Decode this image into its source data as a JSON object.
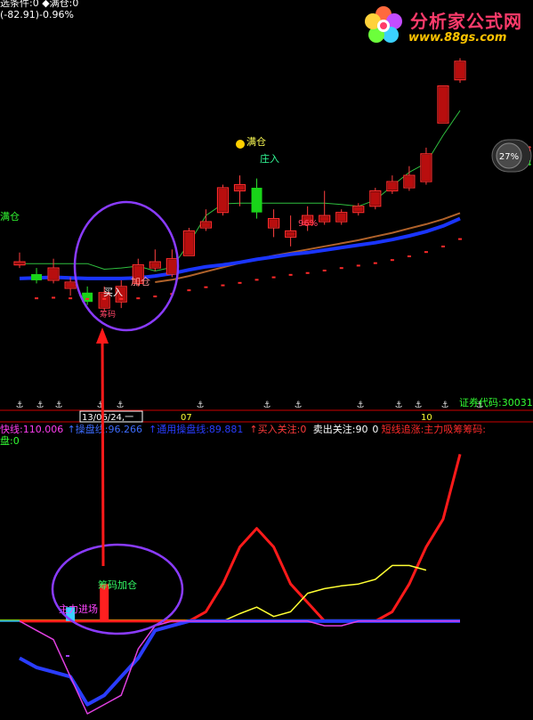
{
  "header": {
    "line1": "选条件:0 ◆满仓:0",
    "line2": "(-82.91)-0.96%"
  },
  "watermark": {
    "title": "分析家公式网",
    "url": "www.88gs.com"
  },
  "gauge": {
    "value": "27%"
  },
  "price_panel": {
    "labels": {
      "jiacang": "加仓",
      "mairu": "买入",
      "zhuangru": "庄入",
      "mancang": "满仓",
      "pct": "96%"
    },
    "pink_note": "筹码",
    "top_left_note": "满仓"
  },
  "time_axis": {
    "date_box": "13/06/24,一",
    "month_07": "07",
    "month_10": "10",
    "code_label": "证券代码:30031"
  },
  "indicator_legend": {
    "items": [
      {
        "text": "快线:110.006",
        "color": "#ff3df0"
      },
      {
        "text": "↑操盘线:96.266",
        "color": "#3d6cff"
      },
      {
        "text": "↑通用操盘线:89.881",
        "color": "#2a3dff"
      },
      {
        "text": "↑买入关注:0",
        "color": "#ff3b3b"
      },
      {
        "text": "卖出关注:90",
        "color": "#ffffff"
      },
      {
        "text": "0",
        "color": "#ffffff"
      },
      {
        "text": "短线追涨:主力吸筹筹码:",
        "color": "#ff2a2a"
      }
    ],
    "line2": "盘:0"
  },
  "annotations": {
    "chouma": "筹码加仓",
    "zhuli": "主力进场"
  },
  "chart_data": [
    {
      "type": "candlestick",
      "candles": [
        {
          "o": 47.0,
          "c": 47.5,
          "h": 49.0,
          "l": 46.5
        },
        {
          "o": 45.5,
          "c": 44.5,
          "h": 46.5,
          "l": 44.0
        },
        {
          "o": 44.5,
          "c": 46.5,
          "h": 48.0,
          "l": 44.0
        },
        {
          "o": 43.2,
          "c": 44.2,
          "h": 45.0,
          "l": 42.0
        },
        {
          "o": 42.5,
          "c": 41.0,
          "h": 43.5,
          "l": 40.5
        },
        {
          "o": 40.0,
          "c": 42.5,
          "h": 43.5,
          "l": 39.5
        },
        {
          "o": 41.0,
          "c": 43.5,
          "h": 44.5,
          "l": 40.0
        },
        {
          "o": 44.0,
          "c": 47.0,
          "h": 48.0,
          "l": 43.5
        },
        {
          "o": 46.5,
          "c": 47.5,
          "h": 49.5,
          "l": 46.0
        },
        {
          "o": 45.5,
          "c": 48.0,
          "h": 49.5,
          "l": 45.0
        },
        {
          "o": 48.5,
          "c": 52.5,
          "h": 53.0,
          "l": 48.5
        },
        {
          "o": 53.0,
          "c": 54.0,
          "h": 56.0,
          "l": 52.5
        },
        {
          "o": 55.5,
          "c": 59.5,
          "h": 60.0,
          "l": 55.0
        },
        {
          "o": 59.0,
          "c": 60.0,
          "h": 61.5,
          "l": 56.5
        },
        {
          "o": 59.5,
          "c": 55.5,
          "h": 61.0,
          "l": 54.5
        },
        {
          "o": 53.0,
          "c": 54.5,
          "h": 56.0,
          "l": 51.5
        },
        {
          "o": 51.5,
          "c": 52.5,
          "h": 55.0,
          "l": 50.0
        },
        {
          "o": 53.5,
          "c": 55.0,
          "h": 56.5,
          "l": 52.5
        },
        {
          "o": 54.0,
          "c": 55.0,
          "h": 59.0,
          "l": 53.5
        },
        {
          "o": 54.0,
          "c": 55.5,
          "h": 56.0,
          "l": 53.5
        },
        {
          "o": 55.5,
          "c": 56.5,
          "h": 57.0,
          "l": 55.0
        },
        {
          "o": 56.5,
          "c": 59.0,
          "h": 59.5,
          "l": 56.0
        },
        {
          "o": 59.0,
          "c": 60.5,
          "h": 61.5,
          "l": 58.5
        },
        {
          "o": 59.5,
          "c": 61.5,
          "h": 63.0,
          "l": 59.0
        },
        {
          "o": 60.5,
          "c": 65.0,
          "h": 66.0,
          "l": 60.0
        },
        {
          "o": 70.0,
          "c": 76.0,
          "h": 76.0,
          "l": 70.0
        },
        {
          "o": 77.0,
          "c": 80.0,
          "h": 80.5,
          "l": 76.5
        }
      ],
      "ma_blue": [
        44.8,
        44.9,
        45.0,
        44.9,
        44.8,
        44.8,
        44.8,
        44.9,
        45.2,
        45.6,
        46.2,
        46.7,
        47.0,
        47.4,
        47.9,
        48.3,
        48.7,
        49.0,
        49.4,
        49.8,
        50.2,
        50.6,
        51.1,
        51.7,
        52.4,
        53.3,
        54.5
      ],
      "ma_brown": [
        null,
        null,
        null,
        null,
        null,
        null,
        null,
        null,
        44.2,
        44.6,
        45.2,
        45.9,
        46.6,
        47.3,
        47.9,
        48.5,
        49.0,
        49.5,
        50.0,
        50.5,
        51.0,
        51.6,
        52.2,
        52.9,
        53.6,
        54.4,
        55.4
      ],
      "ma_green": [
        47.2,
        47.2,
        47.2,
        47.2,
        47.2,
        46.3,
        46.5,
        46.8,
        46.0,
        46.6,
        50.5,
        55.0,
        56.9,
        57.0,
        57.0,
        57.0,
        57.0,
        57.0,
        57.0,
        56.8,
        56.5,
        57.5,
        59.8,
        62.0,
        63.5,
        68.0,
        72.0
      ],
      "ylim": [
        38,
        82
      ]
    },
    {
      "type": "line",
      "x": [
        0,
        1,
        2,
        3,
        4,
        5,
        6,
        7,
        8,
        9,
        10,
        11,
        12,
        13,
        14,
        15,
        16,
        17,
        18,
        19,
        20,
        21,
        22,
        23,
        24,
        25,
        26
      ],
      "series": [
        {
          "color": "#ff1a1a",
          "values": [
            0,
            0,
            0,
            0,
            0,
            0,
            0,
            0,
            0,
            0,
            0,
            10,
            40,
            80,
            100,
            80,
            40,
            20,
            0,
            0,
            0,
            0,
            10,
            40,
            80,
            110,
            180
          ]
        },
        {
          "color": "#ffff33",
          "values": [
            null,
            null,
            null,
            null,
            null,
            null,
            null,
            null,
            null,
            null,
            null,
            null,
            0,
            8,
            15,
            5,
            10,
            30,
            35,
            38,
            40,
            45,
            60,
            60,
            55,
            null,
            null
          ]
        },
        {
          "color": "#2a3dff",
          "values": [
            -40,
            -50,
            -55,
            -60,
            -90,
            -80,
            -60,
            -40,
            -10,
            -5,
            0,
            0,
            0,
            0,
            0,
            0,
            0,
            0,
            0,
            0,
            0,
            0,
            0,
            0,
            0,
            0,
            0
          ]
        },
        {
          "color": "#e040e0",
          "values": [
            0,
            -10,
            -20,
            -60,
            -100,
            -90,
            -80,
            -30,
            -5,
            0,
            0,
            0,
            0,
            0,
            0,
            0,
            0,
            0,
            -5,
            -5,
            0,
            0,
            0,
            0,
            0,
            0,
            0
          ]
        }
      ],
      "baseline": 0,
      "bars": [
        {
          "x": 3,
          "value": 15,
          "color": "#3bd0ff"
        },
        {
          "x": 5,
          "value": 40,
          "color": "#ff2020"
        }
      ],
      "ylim": [
        -100,
        190
      ]
    }
  ]
}
